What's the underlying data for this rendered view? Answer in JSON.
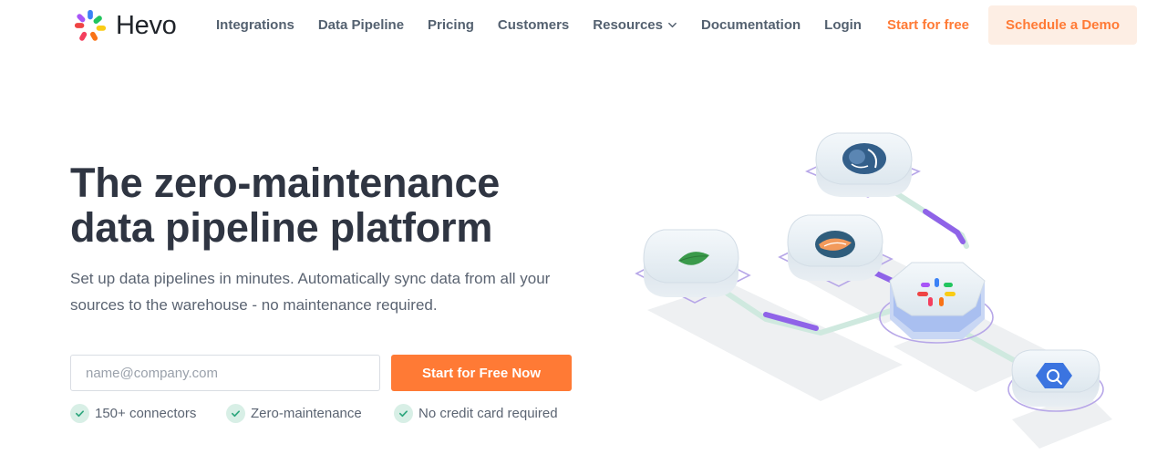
{
  "brand": {
    "name": "Hevo"
  },
  "nav": {
    "items": [
      {
        "label": "Integrations"
      },
      {
        "label": "Data Pipeline"
      },
      {
        "label": "Pricing"
      },
      {
        "label": "Customers"
      },
      {
        "label": "Resources",
        "has_dropdown": true
      },
      {
        "label": "Documentation"
      },
      {
        "label": "Login"
      }
    ],
    "start_label": "Start for free",
    "demo_label": "Schedule a Demo"
  },
  "hero": {
    "headline_line1": "The zero-maintenance",
    "headline_line2": "data pipeline platform",
    "subtitle_line1": "Set up data pipelines in minutes. Automatically sync data from all your",
    "subtitle_line2": "sources to the warehouse - no maintenance required.",
    "email_placeholder": "name@company.com",
    "email_value": "",
    "cta_label": "Start for Free Now",
    "features": [
      {
        "label": "150+ connectors"
      },
      {
        "label": "Zero-maintenance"
      },
      {
        "label": "No credit card required"
      }
    ]
  },
  "illustration": {
    "nodes": [
      {
        "name": "postgresql-icon"
      },
      {
        "name": "mongodb-icon"
      },
      {
        "name": "mysql-icon"
      },
      {
        "name": "hevo-hub-icon"
      },
      {
        "name": "bigquery-icon"
      }
    ]
  },
  "colors": {
    "accent": "#ff7a35",
    "accent_soft": "#fdeee4",
    "heading": "#2f3542",
    "text": "#5b6472",
    "nav": "#546170",
    "check_bg": "#d8efe6",
    "check_mark": "#2fa77e",
    "pipe_purple": "#8f63e8",
    "pipe_green": "#cfe9df"
  }
}
